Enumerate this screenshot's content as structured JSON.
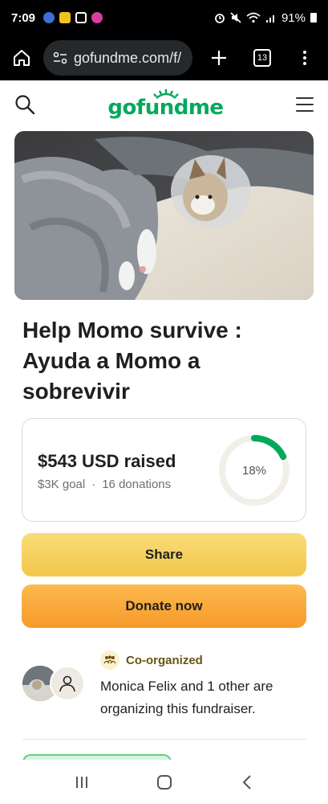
{
  "status_bar": {
    "time": "7:09",
    "battery_percent": "91%",
    "icons": [
      "notification-app-icon",
      "notification-app-icon",
      "gallery-icon",
      "notification-app-icon",
      "alarm-icon",
      "mute-icon",
      "wifi-icon",
      "signal-icon",
      "battery-icon"
    ]
  },
  "browser": {
    "url": "gofundme.com/f/",
    "tab_count": "13",
    "icons": [
      "home-icon",
      "site-settings-icon",
      "new-tab-icon",
      "tabs-icon",
      "more-menu-icon"
    ]
  },
  "site_header": {
    "logo_text": "gofundme",
    "icons": [
      "search-icon",
      "hamburger-menu-icon"
    ]
  },
  "campaign": {
    "title": "Help Momo survive : Ayuda a Momo a sobrevivir",
    "raised": "$543 USD raised",
    "goal": "$3K goal",
    "separator": "·",
    "donations": "16 donations",
    "progress_label": "18%",
    "progress_fraction": 0.18
  },
  "actions": {
    "share_label": "Share",
    "donate_label": "Donate now"
  },
  "organizers": {
    "badge_label": "Co-organized",
    "description": "Monica Felix and 1 other are organizing this fundraiser."
  },
  "colors": {
    "brand_green": "#02a95c",
    "share_yellow": "#f3c64a",
    "donate_orange": "#f79a2a",
    "status_black": "#000000"
  },
  "nav_bar": {
    "icons": [
      "recent-apps-icon",
      "home-button-icon",
      "back-icon"
    ]
  }
}
